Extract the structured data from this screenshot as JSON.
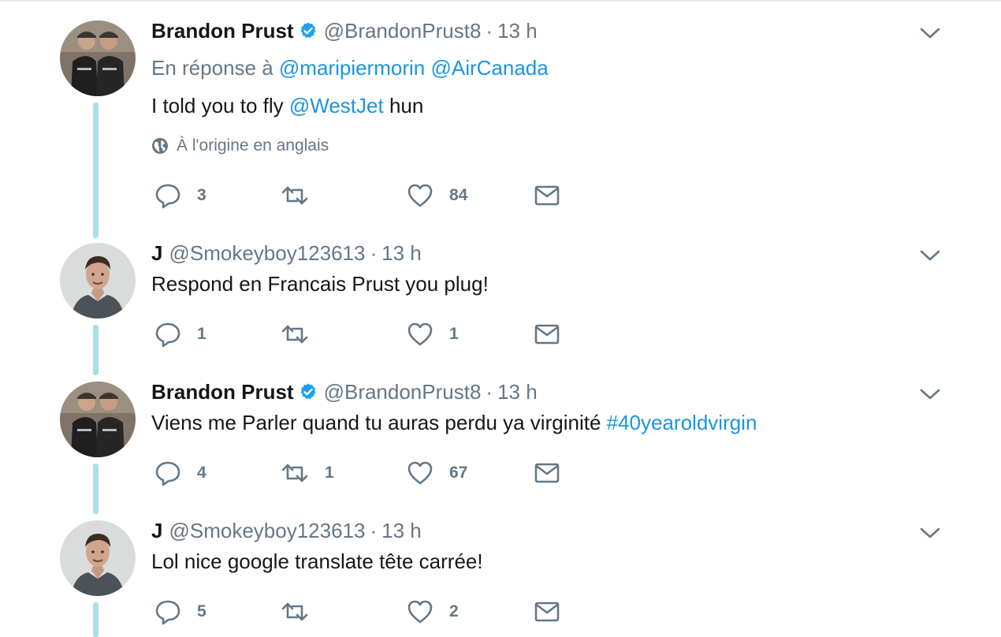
{
  "colors": {
    "link": "#1b95e0",
    "secondary_text": "#657786",
    "primary_text": "#14171a",
    "thread_line": "#a9dfe9",
    "verified": "#1da1f2"
  },
  "tweets": [
    {
      "name": "Brandon Prust",
      "verified": true,
      "handle": "@BrandonPrust8",
      "time": "13 h",
      "reply_prefix": "En réponse à",
      "reply_to_1": "@maripiermorin",
      "reply_to_2": "@AirCanada",
      "text_before": "I told you to fly ",
      "text_link": "@WestJet",
      "text_after": " hun",
      "translate_label": "À l'origine en anglais",
      "replies": "3",
      "retweets": "",
      "likes": "84"
    },
    {
      "name": "J",
      "verified": false,
      "handle": "@Smokeyboy123613",
      "time": "13 h",
      "text": "Respond en Francais Prust you plug!",
      "replies": "1",
      "retweets": "",
      "likes": "1"
    },
    {
      "name": "Brandon Prust",
      "verified": true,
      "handle": "@BrandonPrust8",
      "time": "13 h",
      "text_before": "Viens me Parler quand tu auras perdu ya virginité ",
      "text_link": "#40yearoldvirgin",
      "replies": "4",
      "retweets": "1",
      "likes": "67"
    },
    {
      "name": "J",
      "verified": false,
      "handle": "@Smokeyboy123613",
      "time": "13 h",
      "text": "Lol nice google translate tête carrée!",
      "replies": "5",
      "retweets": "",
      "likes": "2"
    }
  ]
}
